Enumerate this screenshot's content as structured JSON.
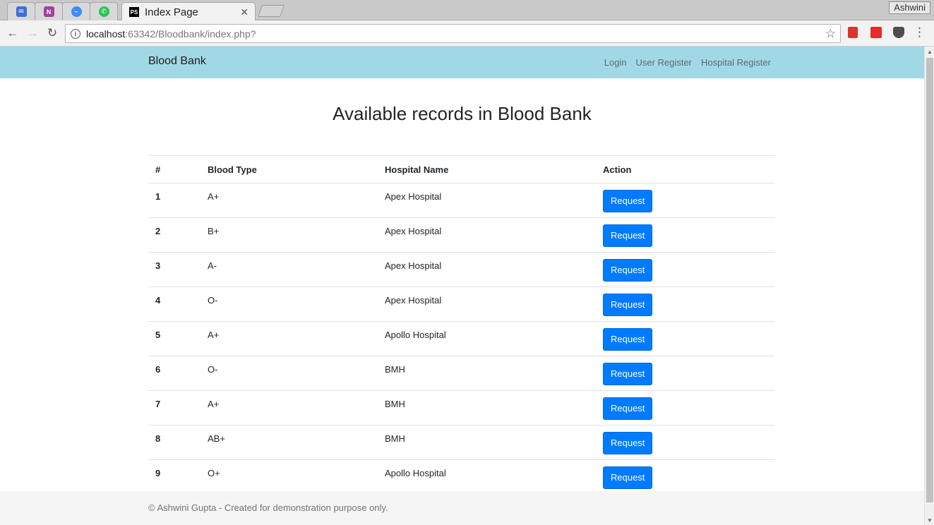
{
  "browser": {
    "tabs": [
      {
        "icon": "inbox-mail-icon",
        "color": "#3f6fd8"
      },
      {
        "icon": "onenote-icon",
        "color": "#a33ea1"
      },
      {
        "icon": "messenger-icon",
        "color": "#3a8bff"
      },
      {
        "icon": "whatsapp-icon",
        "color": "#2cc34f"
      }
    ],
    "active_tab": {
      "title": "Index Page",
      "icon_text": "PS"
    },
    "profile": "Ashwini",
    "url_host": "localhost",
    "url_path": ":63342/Bloodbank/index.php?"
  },
  "navbar": {
    "brand": "Blood Bank",
    "links": [
      "Login",
      "User Register",
      "Hospital Register"
    ],
    "color": "#a1d8e6"
  },
  "main": {
    "heading": "Available records in Blood Bank",
    "columns": [
      "#",
      "Blood Type",
      "Hospital Name",
      "Action"
    ],
    "rows": [
      {
        "num": "1",
        "type": "A+",
        "hospital": "Apex Hospital",
        "action": "Request"
      },
      {
        "num": "2",
        "type": "B+",
        "hospital": "Apex Hospital",
        "action": "Request"
      },
      {
        "num": "3",
        "type": "A-",
        "hospital": "Apex Hospital",
        "action": "Request"
      },
      {
        "num": "4",
        "type": "O-",
        "hospital": "Apex Hospital",
        "action": "Request"
      },
      {
        "num": "5",
        "type": "A+",
        "hospital": "Apollo Hospital",
        "action": "Request"
      },
      {
        "num": "6",
        "type": "O-",
        "hospital": "BMH",
        "action": "Request"
      },
      {
        "num": "7",
        "type": "A+",
        "hospital": "BMH",
        "action": "Request"
      },
      {
        "num": "8",
        "type": "AB+",
        "hospital": "BMH",
        "action": "Request"
      },
      {
        "num": "9",
        "type": "O+",
        "hospital": "Apollo Hospital",
        "action": "Request"
      }
    ],
    "button_color": "#007bff"
  },
  "footer": {
    "text": "© Ashwini Gupta - Created for demonstration purpose only."
  }
}
